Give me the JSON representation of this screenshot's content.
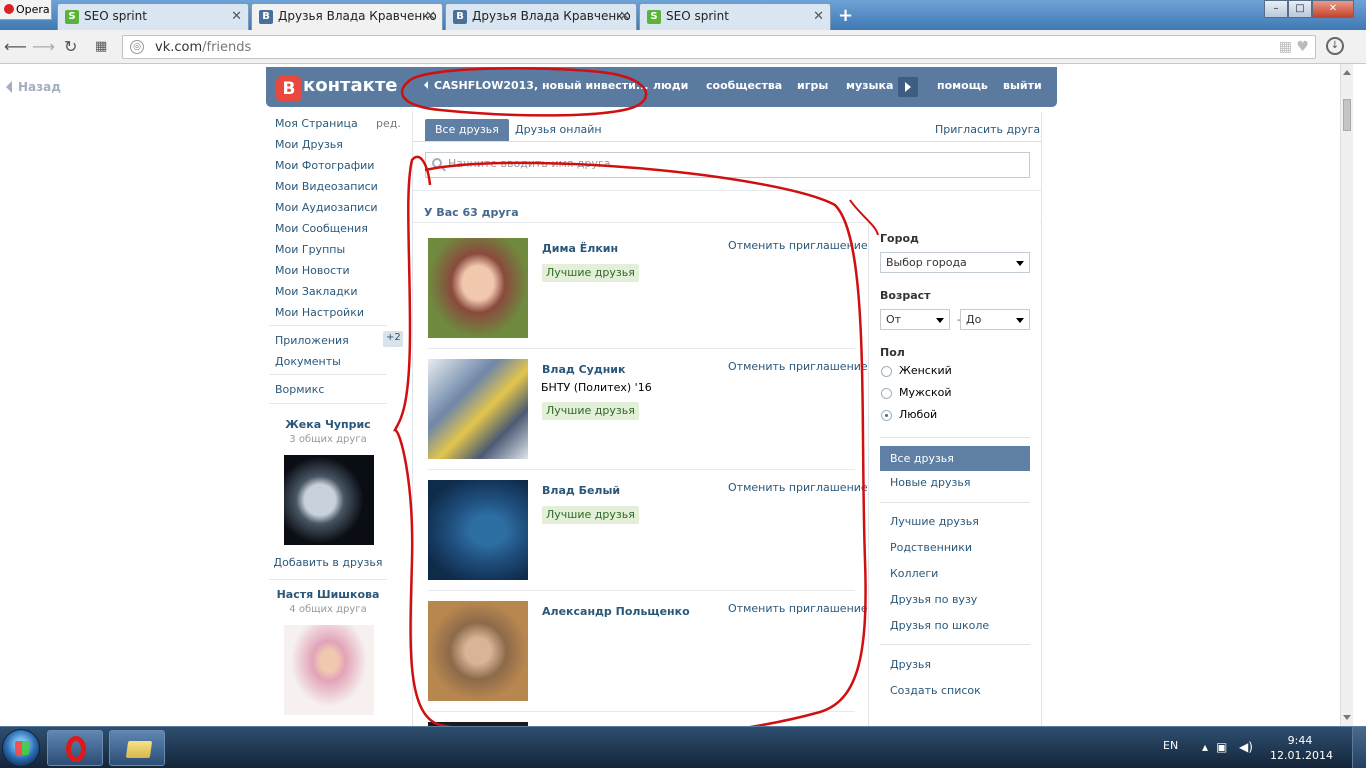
{
  "browser": {
    "opera_menu_label": "Opera",
    "tabs": [
      {
        "title": "SEO sprint",
        "favicon": "seo-sprint-icon",
        "active": false
      },
      {
        "title": "Друзья Влада Кравченко",
        "favicon": "vk-icon",
        "active": true
      },
      {
        "title": "Друзья Влада Кравченко",
        "favicon": "vk-icon",
        "active": false
      },
      {
        "title": "SEO sprint",
        "favicon": "seo-sprint-icon",
        "active": false
      }
    ],
    "url_domain": "vk.com",
    "url_path": "/friends"
  },
  "page": {
    "back_label": "Назад",
    "header": {
      "logo_text": "контакте",
      "logo_letter": "В",
      "status": "CASHFLOW2013, новый инвести...",
      "nav": [
        "люди",
        "сообщества",
        "игры",
        "музыка",
        "помощь",
        "выйти"
      ],
      "brand_color": "#5a7a9f"
    },
    "left_menu": {
      "items": [
        "Моя Страница",
        "Мои Друзья",
        "Мои Фотографии",
        "Мои Видеозаписи",
        "Мои Аудиозаписи",
        "Мои Сообщения",
        "Мои Группы",
        "Мои Новости",
        "Мои Закладки",
        "Мои Настройки"
      ],
      "edit_label": "ред.",
      "extra_items": [
        "Приложения",
        "Документы"
      ],
      "apps_counter": "+2",
      "app_item": "Вормикс",
      "suggestions": [
        {
          "name": "Жека Чуприс",
          "mutual": "3 общих друга",
          "add_label": "Добавить в друзья",
          "photo": "space-planet-photo"
        },
        {
          "name": "Настя Шишкова",
          "mutual": "4 общих друга",
          "photo": "girl-photo"
        }
      ]
    },
    "friends": {
      "tabs": [
        "Все друзья",
        "Друзья онлайн"
      ],
      "invite_label": "Пригласить друга",
      "search_placeholder": "Начните вводить имя друга",
      "count_title": "У Вас 63 друга",
      "list": [
        {
          "name": "Дима Ёлкин",
          "cancel": "Отменить приглашение",
          "badge": "Лучшие друзья",
          "uni": "",
          "photo": "dima-photo"
        },
        {
          "name": "Влад Судник",
          "cancel": "Отменить приглашение",
          "badge": "Лучшие друзья",
          "uni": "БНТУ (Политех) '16",
          "photo": "robot-art-photo"
        },
        {
          "name": "Влад Белый",
          "cancel": "Отменить приглашение",
          "badge": "Лучшие друзья",
          "uni": "",
          "photo": "blue-photo"
        },
        {
          "name": "Александр Польщенко",
          "cancel": "Отменить приглашение",
          "badge": "",
          "uni": "",
          "photo": "alexander-photo"
        }
      ]
    },
    "filters": {
      "city_title": "Город",
      "city_select": "Выбор города",
      "age_title": "Возраст",
      "age_from": "От",
      "age_dash": "-",
      "age_to": "До",
      "sex_title": "Пол",
      "sex_options": [
        "Женский",
        "Мужской",
        "Любой"
      ],
      "sex_selected": "Любой",
      "lists_active": "Все друзья",
      "lists": [
        "Новые друзья",
        "Лучшие друзья",
        "Родственники",
        "Коллеги",
        "Друзья по вузу",
        "Друзья по школе",
        "Друзья",
        "Создать список"
      ]
    }
  },
  "taskbar": {
    "language": "EN",
    "time": "9:44",
    "date": "12.01.2014"
  }
}
